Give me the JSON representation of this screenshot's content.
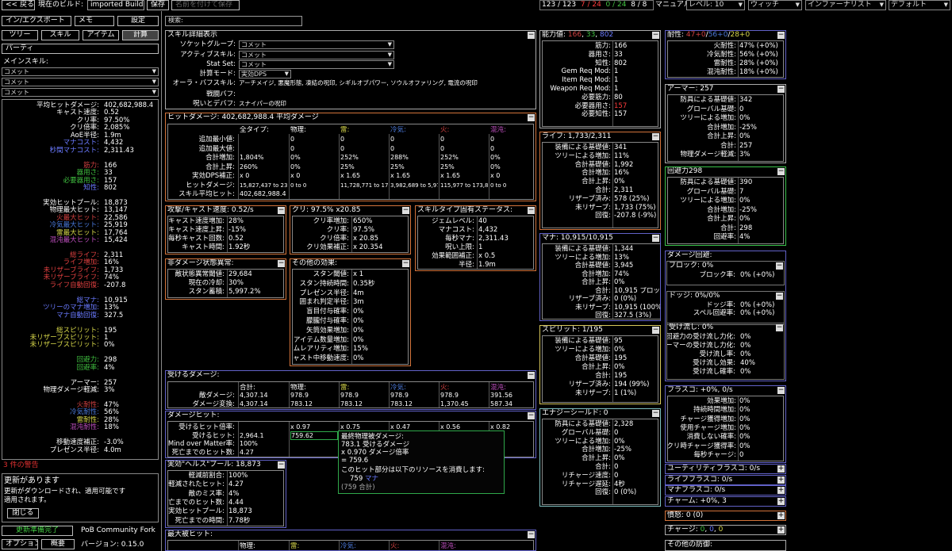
{
  "topbar": {
    "back": "<< 戻る",
    "current_build_label": "現在のビルド:",
    "build_name": "imported Build",
    "save": "保存",
    "save_as": "名前を付けて保存",
    "points": "123 / 123",
    "ascend": "7 / 24",
    "ascend2": "0 / 24",
    "weapon_set": "8 / 8",
    "level_label": "マニュアル",
    "level": "レベル: 10",
    "class": "ウィッチ",
    "ascendancy": "インファーナリスト",
    "config": "デフォルト"
  },
  "left": {
    "import_export": "イン/エクスポート",
    "notes": "メモ",
    "settings": "設定",
    "tabs": [
      "ツリー",
      "スキル",
      "アイテム",
      "計算"
    ],
    "party": "パーティ",
    "main_skill_label": "メインスキル:",
    "skill_sel": [
      "コメット",
      "コメット",
      "コメット"
    ],
    "stats": [
      {
        "l": "平均ヒットダメージ:",
        "v": "402,682,988.4",
        "c": ""
      },
      {
        "l": "キャスト速度:",
        "v": "0.52",
        "c": ""
      },
      {
        "l": "クリ率:",
        "v": "97.50%",
        "c": ""
      },
      {
        "l": "クリ倍率:",
        "v": "2,085%",
        "c": ""
      },
      {
        "l": "AoE半径:",
        "v": "1.9m",
        "c": ""
      },
      {
        "l": "マナコスト:",
        "v": "4,432",
        "c": "c-mana"
      },
      {
        "l": "秒間マナコスト:",
        "v": "2,311.43",
        "c": "c-mana"
      },
      {
        "l": "",
        "v": "",
        "c": ""
      },
      {
        "l": "筋力:",
        "v": "166",
        "c": "c-str"
      },
      {
        "l": "器用さ:",
        "v": "33",
        "c": "c-dex"
      },
      {
        "l": "必要器用さ:",
        "v": "157",
        "c": "c-dex"
      },
      {
        "l": "知性:",
        "v": "802",
        "c": "c-int"
      },
      {
        "l": "",
        "v": "",
        "c": ""
      },
      {
        "l": "実効ヒットプール:",
        "v": "18,873",
        "c": ""
      },
      {
        "l": "物理最大ヒット:",
        "v": "13,147",
        "c": ""
      },
      {
        "l": "火最大ヒット:",
        "v": "22,586",
        "c": "c-fire"
      },
      {
        "l": "冷気最大ヒット:",
        "v": "25,919",
        "c": "c-cold"
      },
      {
        "l": "雷最大ヒット:",
        "v": "17,764",
        "c": "c-light"
      },
      {
        "l": "混沌最大ヒット:",
        "v": "15,424",
        "c": "c-chaos"
      },
      {
        "l": "",
        "v": "",
        "c": ""
      },
      {
        "l": "総ライフ:",
        "v": "2,311",
        "c": "c-life"
      },
      {
        "l": "ライフ増加:",
        "v": "16%",
        "c": "c-life"
      },
      {
        "l": "未リザーブライフ:",
        "v": "1,733",
        "c": "c-life"
      },
      {
        "l": "未リザーブライフ:",
        "v": "74%",
        "c": "c-life"
      },
      {
        "l": "ライフ自動回復:",
        "v": "-207.8",
        "c": "c-life"
      },
      {
        "l": "",
        "v": "",
        "c": ""
      },
      {
        "l": "総マナ:",
        "v": "10,915",
        "c": "c-mana"
      },
      {
        "l": "ツリーのマナ増加:",
        "v": "13%",
        "c": "c-mana"
      },
      {
        "l": "マナ自動回復:",
        "v": "327.5",
        "c": "c-mana"
      },
      {
        "l": "",
        "v": "",
        "c": ""
      },
      {
        "l": "総スピリット:",
        "v": "195",
        "c": "c-light"
      },
      {
        "l": "未リザーブスピリット:",
        "v": "1",
        "c": "c-light"
      },
      {
        "l": "未リザーブスピリット:",
        "v": "0%",
        "c": "c-light"
      },
      {
        "l": "",
        "v": "",
        "c": ""
      },
      {
        "l": "回避力:",
        "v": "298",
        "c": "c-dex"
      },
      {
        "l": "回避率:",
        "v": "4%",
        "c": "c-dex"
      },
      {
        "l": "",
        "v": "",
        "c": ""
      },
      {
        "l": "アーマー:",
        "v": "257",
        "c": ""
      },
      {
        "l": "物理ダメージ軽減:",
        "v": "3%",
        "c": ""
      },
      {
        "l": "",
        "v": "",
        "c": ""
      },
      {
        "l": "火耐性:",
        "v": "47%",
        "c": "c-fire"
      },
      {
        "l": "冷気耐性:",
        "v": "56%",
        "c": "c-cold"
      },
      {
        "l": "雷耐性:",
        "v": "28%",
        "c": "c-light"
      },
      {
        "l": "混沌耐性:",
        "v": "18%",
        "c": "c-chaos"
      },
      {
        "l": "",
        "v": "",
        "c": ""
      },
      {
        "l": "移動速度補正:",
        "v": "-3.0%",
        "c": ""
      },
      {
        "l": "プレゼンス半径:",
        "v": "4.0m",
        "c": ""
      }
    ],
    "warning": "3 件の警告",
    "update_title": "更新があります",
    "update_body": "更新がダウンロードされ、適用可能です\n適用されます。",
    "close": "閉じる",
    "update_ready": "更新準備完了",
    "fork": "PoB Community Fork",
    "options": "オプション",
    "about": "概要",
    "version": "バージョン: 0.15.0"
  },
  "search": {
    "label": "検索:"
  },
  "skill_detail": {
    "title": "スキル詳細表示",
    "rows": [
      [
        "ソケットグループ:",
        "コメット"
      ],
      [
        "アクティブスキル:",
        "コメット"
      ],
      [
        "Stat Set:",
        "コメット"
      ],
      [
        "計算モード:",
        "実効DPS"
      ],
      [
        "オーラ・バフスキル:",
        "アーチメイジ, 悪魔形態, 凍結の呪印, シギルオブパワー, ソウルオファリング, 電流の呪印"
      ],
      [
        "戦闘バフ:",
        ""
      ],
      [
        "呪いとデバフ:",
        "スナイパーの呪印"
      ]
    ]
  },
  "hit_damage": {
    "title": "ヒットダメージ: 402,682,988.4 平均ダメージ",
    "headers": [
      "全タイプ:",
      "物理:",
      "雷:",
      "冷気:",
      "火:",
      "混沌:"
    ],
    "rows": [
      {
        "l": "追加最小値:",
        "c": [
          "",
          "0",
          "0",
          "0",
          "0",
          "0"
        ]
      },
      {
        "l": "追加最大値:",
        "c": [
          "",
          "0",
          "0",
          "0",
          "0",
          "0"
        ]
      },
      {
        "l": "合計増加:",
        "c": [
          "1,804%",
          "0%",
          "252%",
          "288%",
          "252%",
          "0%"
        ]
      },
      {
        "l": "合計上昇:",
        "c": [
          "260%",
          "0%",
          "25%",
          "25%",
          "25%",
          "0%"
        ]
      },
      {
        "l": "実効DPS補正:",
        "c": [
          "x 0",
          "x 0",
          "x 1.65",
          "x 1.65",
          "x 1.65",
          "x 0"
        ]
      },
      {
        "l": "ヒットダメージ:",
        "c": [
          "15,827,437 to 23,7",
          "0 to 0",
          "11,728,771 to 17,5",
          "3,982,689 to 5,974",
          "115,977 to 173,80",
          "0 to 0"
        ]
      },
      {
        "l": "スキル平均ヒット:",
        "c": [
          "402,682,988.4",
          "",
          "",
          "",
          "",
          ""
        ]
      }
    ]
  },
  "attack": {
    "title": "攻撃/キャスト速度: 0.52/s",
    "rows": [
      [
        "キャスト速度増加:",
        "28%"
      ],
      [
        "キャスト速度上昇:",
        "-15%"
      ],
      [
        "毎秒キャスト回数:",
        "0.52"
      ],
      [
        "キャスト時間:",
        "1.92秒"
      ]
    ]
  },
  "crit": {
    "title": "クリ: 97.5% x20.85",
    "rows": [
      [
        "クリ率増加:",
        "650%"
      ],
      [
        "クリ率:",
        "97.5%"
      ],
      [
        "クリ倍率:",
        "x 20.85"
      ],
      [
        "クリ効果補正:",
        "x 20.354"
      ]
    ]
  },
  "skilltype": {
    "title": "スキルタイプ固有ステータス:",
    "rows": [
      [
        "ジェムレベル:",
        "40"
      ],
      [
        "マナコスト:",
        "4,432"
      ],
      [
        "毎秒マナ:",
        "2,311.43"
      ],
      [
        "呪い上限:",
        "1"
      ],
      [
        "効果範囲補正:",
        "x 0.5"
      ],
      [
        "半径:",
        "1.9m"
      ]
    ]
  },
  "ailment": {
    "title": "非ダメージ状態異常:",
    "rows": [
      [
        "敵状態異常閾値:",
        "29,684"
      ],
      [
        "現在の冷却:",
        "30%"
      ],
      [
        "スタン蓄積:",
        "5,997.2%"
      ]
    ]
  },
  "other_effects": {
    "title": "その他の効果:",
    "rows": [
      [
        "スタン閾値:",
        "x 1"
      ],
      [
        "スタン持続時間:",
        "0.35秒"
      ],
      [
        "プレゼンス半径:",
        "4m"
      ],
      [
        "囲まれ判定半径:",
        "3m"
      ],
      [
        "盲目付与確率:",
        "0%"
      ],
      [
        "朦朧付与確率:",
        "0%"
      ],
      [
        "矢筒効果増加:",
        "0%"
      ],
      [
        "アイテム数量増加:",
        "0%"
      ],
      [
        "アイテムレアリティ増加:",
        "15%"
      ],
      [
        "キャスト中移動速度:",
        "0%"
      ]
    ]
  },
  "taken": {
    "title": "受けるダメージ:",
    "headers": [
      "合計:",
      "物理:",
      "雷:",
      "冷気:",
      "火:",
      "混沌:"
    ],
    "rows": [
      {
        "l": "敵ダメージ:",
        "c": [
          "4,307.14",
          "978.9",
          "978.9",
          "978.9",
          "978.9",
          "391.56"
        ]
      },
      {
        "l": "ダメージ変換:",
        "c": [
          "4,307.14",
          "783.12",
          "783.12",
          "783.12",
          "1,370.45",
          "587.34"
        ]
      }
    ]
  },
  "dmg_hit": {
    "title": "ダメージヒット:",
    "rows": [
      [
        "受けるヒット倍率:",
        "",
        "x 0.97",
        "x 0.75",
        "x 0.47",
        "x 0.56",
        "x 0.82"
      ],
      [
        "受けるヒット:",
        "2,964.1",
        "759.62",
        "",
        "",
        "",
        ""
      ],
      [
        "Mind over Matter率:",
        "100%",
        "",
        "",
        "",
        "",
        ""
      ],
      [
        "死亡までのヒット数:",
        "4.27",
        "",
        "",
        "",
        "",
        ""
      ]
    ]
  },
  "tooltip": {
    "l1": "最終物理被ダメージ:",
    "l2": "783.1 受けるダメージ",
    "l3": "x 0.970 ダメージ倍率",
    "l4": "= 759.6",
    "l5": "このヒット部分は以下のリソースを消費します:",
    "l6a": "759",
    "l6b": "マナ",
    "l7": "(759 合計)"
  },
  "ehp": {
    "title": "実効\"ヘルス\"プール: 18,873",
    "rows": [
      [
        "軽減前割合:",
        "100%"
      ],
      [
        "軽減されたヒット:",
        "4.27"
      ],
      [
        "敵のミス率:",
        "4%"
      ],
      [
        "死亡までのヒット数:",
        "4.44"
      ],
      [
        "実効ヒットプール:",
        "18,873"
      ],
      [
        "死亡までの時間:",
        "7.78秒"
      ]
    ]
  },
  "maxhit": {
    "title": "最大被ヒット:",
    "headers": [
      "物理:",
      "雷:",
      "冷気:",
      "火:",
      "混沌:"
    ]
  },
  "attrs": {
    "t": "能力値:",
    "v1": "166",
    "v2": "33",
    "v3": "802",
    "rows": [
      [
        "筋力:",
        "166",
        ""
      ],
      [
        "器用さ:",
        "33",
        ""
      ],
      [
        "知性:",
        "802",
        ""
      ],
      [
        "Gem Req Mod:",
        "1",
        ""
      ],
      [
        "Item Req Mod:",
        "1",
        ""
      ],
      [
        "Weapon Req Mod:",
        "1",
        ""
      ],
      [
        "必要筋力:",
        "80",
        ""
      ],
      [
        "必要器用さ:",
        "157",
        "c-red"
      ],
      [
        "必要知性:",
        "157",
        ""
      ]
    ]
  },
  "life": {
    "title": "ライフ: 1,733/2,311",
    "rows": [
      [
        "装備による基礎値:",
        "341"
      ],
      [
        "ツリーによる増加:",
        "11%"
      ],
      [
        "合計基礎値:",
        "1,992"
      ],
      [
        "合計増加:",
        "16%"
      ],
      [
        "合計上昇:",
        "0%"
      ],
      [
        "合計:",
        "2,311"
      ],
      [
        "リザーブ済み:",
        "578 (25%)"
      ],
      [
        "未リザーブ:",
        "1,733 (75%)"
      ],
      [
        "回復:",
        "-207.8 (-9%)"
      ]
    ]
  },
  "mana": {
    "title": "マナ: 10,915/10,915",
    "rows": [
      [
        "装備による基礎値:",
        "1,344"
      ],
      [
        "ツリーによる増加:",
        "13%"
      ],
      [
        "合計基礎値:",
        "3,945"
      ],
      [
        "合計増加:",
        "74%"
      ],
      [
        "合計上昇:",
        "0%"
      ],
      [
        "合計:",
        "10,915 ブロックから受けるダメージ:"
      ],
      [
        "リザーブ済み:",
        "0 (0%)"
      ],
      [
        "未リザーブ:",
        "10,915 (100%)"
      ],
      [
        "回復:",
        "327.5 (3%)"
      ]
    ]
  },
  "spirit": {
    "title": "スピリット: 1/195",
    "rows": [
      [
        "装備による基礎値:",
        "95"
      ],
      [
        "ツリーによる増加:",
        "0%"
      ],
      [
        "合計基礎値:",
        "195"
      ],
      [
        "合計上昇:",
        "0%"
      ],
      [
        "合計:",
        "195"
      ],
      [
        "リザーブ済み:",
        "194 (99%)"
      ],
      [
        "未リザーブ:",
        "1 (1%)"
      ]
    ]
  },
  "es": {
    "title": "エナジーシールド: 0",
    "rows": [
      [
        "防具による基礎値:",
        "2,328"
      ],
      [
        "グローバル基礎:",
        "0"
      ],
      [
        "ツリーによる増加:",
        "0%"
      ],
      [
        "合計増加:",
        "-25%"
      ],
      [
        "合計上昇:",
        "0%"
      ],
      [
        "合計:",
        "0"
      ],
      [
        "リチャージ速度:",
        "0"
      ],
      [
        "リチャージ遅延:",
        "4秒"
      ],
      [
        "回復:",
        "0 (0%)"
      ]
    ]
  },
  "resist": {
    "t": "耐性:",
    "v1": "47+0",
    "v2": "56+0",
    "v3": "28+0",
    "rows": [
      [
        "火耐性:",
        "47% (+0%)"
      ],
      [
        "冷気耐性:",
        "56% (+0%)"
      ],
      [
        "雷耐性:",
        "28% (+0%)"
      ],
      [
        "混沌耐性:",
        "18% (+0%)"
      ]
    ]
  },
  "armour": {
    "title": "アーマー: 257",
    "rows": [
      [
        "防具による基礎値:",
        "342"
      ],
      [
        "グローバル基礎:",
        "0"
      ],
      [
        "ツリーによる増加:",
        "0%"
      ],
      [
        "合計増加:",
        "-25%"
      ],
      [
        "合計上昇:",
        "0%"
      ],
      [
        "合計:",
        "257"
      ],
      [
        "物理ダメージ軽減:",
        "3%"
      ]
    ]
  },
  "evasion": {
    "title": "回避力298",
    "rows": [
      [
        "防具による基礎値:",
        "390"
      ],
      [
        "グローバル基礎:",
        "7"
      ],
      [
        "ツリーによる増加:",
        "0%"
      ],
      [
        "合計増加:",
        "-25%"
      ],
      [
        "合計上昇:",
        "0%"
      ],
      [
        "合計:",
        "298"
      ],
      [
        "回避率:",
        "4%"
      ]
    ]
  },
  "dmgrec": {
    "title": "ダメージ回避:"
  },
  "block": {
    "title": "ブロック: 0%",
    "rows": [
      [
        "ブロック率:",
        "0% (+0%)"
      ]
    ]
  },
  "dodge": {
    "title": "ドッジ: 0%/0%",
    "rows": [
      [
        "ドッジ率:",
        "0% (+0%)"
      ],
      [
        "スペル回避率:",
        "0% (+0%)"
      ]
    ]
  },
  "deflect": {
    "title": "受け流し: 0%",
    "rows": [
      [
        "回避力の受け流し力化:",
        "0%"
      ],
      [
        "アーマーの受け流し力化:",
        "0%"
      ],
      [
        "受け流し率:",
        "0%"
      ],
      [
        "受け流し効果:",
        "40%"
      ],
      [
        "受け流し確率:",
        "0%"
      ]
    ]
  },
  "flask": {
    "title": "フラスコ: +0%, 0/s",
    "rows": [
      [
        "効果増加:",
        "0%"
      ],
      [
        "持続時間増加:",
        "0%"
      ],
      [
        "チャージ獲得増加:",
        "0%"
      ],
      [
        "使用チャージ増加:",
        "0%"
      ],
      [
        "消費しない確率:",
        "0%"
      ],
      [
        "クリ時チャージ獲得率:",
        "0%"
      ],
      [
        "毎秒チャージ:",
        "0"
      ]
    ]
  },
  "collapsed": [
    {
      "t": "ユーティリティフラスコ: 0/s"
    },
    {
      "t": "ライフフラスコ: 0/s"
    },
    {
      "t": "マナフラスコ: 0/s"
    },
    {
      "t": "チャーム: +0%, 3"
    }
  ],
  "rage": {
    "t": "憤怒: 0 (0)"
  },
  "charges": {
    "t": "チャージ:",
    "v1": "0",
    "v2": "0",
    "v3": "0"
  },
  "otherdef": {
    "t": "その他の防御:"
  }
}
